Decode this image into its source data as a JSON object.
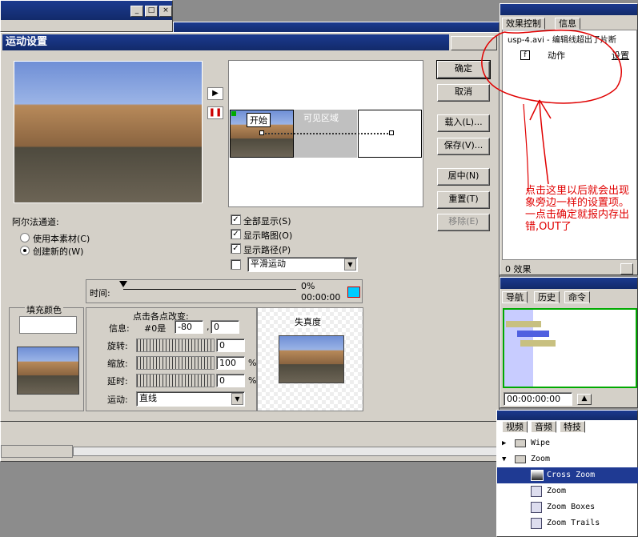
{
  "dialog": {
    "title": "运动设置",
    "preview": {
      "play_icon": "play-icon",
      "pause_icon": "pause-icon"
    },
    "buttons": {
      "ok": "确定",
      "cancel": "取消",
      "load": "载入(L)...",
      "save": "保存(V)...",
      "center": "居中(N)",
      "reset": "重置(T)",
      "remove": "移除(E)"
    },
    "path_area": {
      "start_label": "开始",
      "visible_area_label": "可见区域"
    },
    "alpha": {
      "label": "阿尔法通道:",
      "option_use": "使用本素材(C)",
      "option_create": "创建新的(W)",
      "selected": "创建新的(W)"
    },
    "options": {
      "show_all": "全部显示(S)",
      "show_outline": "显示略图(O)",
      "show_path": "显示路径(P)",
      "smooth_motion": "平滑运动",
      "motion_select": ""
    },
    "time": {
      "label": "时间:",
      "percent": "0%",
      "timecode": "00:00:00"
    },
    "fill": {
      "label": "填充颜色"
    },
    "points": {
      "title": "点击各点改变:",
      "info_label": "信息:",
      "info_point": "#0是",
      "info_x": "-80",
      "info_sep": ",",
      "info_y": "0",
      "rotate_label": "旋转:",
      "rotate_value": "0",
      "zoom_label": "缩放:",
      "zoom_value": "100",
      "zoom_unit": "%",
      "delay_label": "延时:",
      "delay_value": "0",
      "delay_unit": "%",
      "motion_label": "运动:",
      "motion_value": "直线"
    },
    "distortion": {
      "label": "失真度"
    }
  },
  "effect_controls": {
    "tabs": [
      "效果控制",
      "信息"
    ],
    "clip_line": "usp-4.avi - 编辑线超出了片断",
    "row_label": "动作",
    "row_setup": "设置",
    "footer": "0 效果"
  },
  "annotation": {
    "text": "点击这里以后就会出现象旁边一样的设置项。一点击确定就报内存出错,OUT了",
    "color": "#ff0000"
  },
  "navigator": {
    "tabs": [
      "导航",
      "历史",
      "命令"
    ],
    "timecode": "00:00:00:00"
  },
  "effects_panel": {
    "tabs": [
      "视频",
      "音频",
      "特技"
    ],
    "items": [
      {
        "label": "Wipe",
        "type": "folder"
      },
      {
        "label": "Zoom",
        "type": "folder"
      },
      {
        "label": "Cross Zoom",
        "type": "item",
        "selected": true
      },
      {
        "label": "Zoom",
        "type": "item"
      },
      {
        "label": "Zoom Boxes",
        "type": "item"
      },
      {
        "label": "Zoom Trails",
        "type": "item"
      }
    ]
  }
}
